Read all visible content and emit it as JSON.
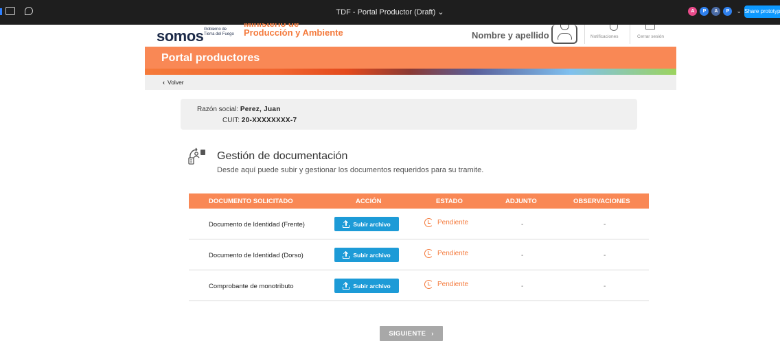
{
  "figma": {
    "file_title": "TDF - Portal Productor (Draft) ⌄",
    "avatars": [
      {
        "letter": "A",
        "color": "#e94b8a"
      },
      {
        "letter": "P",
        "color": "#2f80ed"
      },
      {
        "letter": "A",
        "color": "#4a6ba6"
      },
      {
        "letter": "P",
        "color": "#2f80ed"
      }
    ],
    "share_label": "Share prototype"
  },
  "header": {
    "logo_somos": "somos",
    "logo_gov_line1": "Gobierno de",
    "logo_gov_line2": "Tierra del Fuego",
    "ministry_line1": "Ministerio de",
    "ministry_line2": "Producción y Ambiente",
    "user_name": "Nombre y apellido",
    "notifications_label": "Notificaciones",
    "logout_label": "Cerrar sesión"
  },
  "portal": {
    "title": "Portal productores",
    "back_label": "Volver"
  },
  "company": {
    "razon_label": "Razón social:",
    "razon_value": "Perez, Juan",
    "cuit_label": "CUIT:",
    "cuit_value": "20-XXXXXXXX-7"
  },
  "docs": {
    "title": "Gestión de documentación",
    "subtitle": "Desde aquí puede subir y gestionar los documentos requeridos para su tramite.",
    "columns": [
      "DOCUMENTO SOLICITADO",
      "ACCIÓN",
      "ESTADO",
      "ADJUNTO",
      "OBSERVACIONES"
    ],
    "rows": [
      {
        "document": "Documento de Identidad (Frente)",
        "action": "Subir archivo",
        "status": "Pendiente",
        "attachment": "-",
        "observations": "-"
      },
      {
        "document": "Documento de Identidad (Dorso)",
        "action": "Subir archivo",
        "status": "Pendiente",
        "attachment": "-",
        "observations": "-"
      },
      {
        "document": "Comprobante de monotributo",
        "action": "Subir archivo",
        "status": "Pendiente",
        "attachment": "-",
        "observations": "-"
      }
    ]
  },
  "footer": {
    "next_label": "SIGUIENTE"
  }
}
